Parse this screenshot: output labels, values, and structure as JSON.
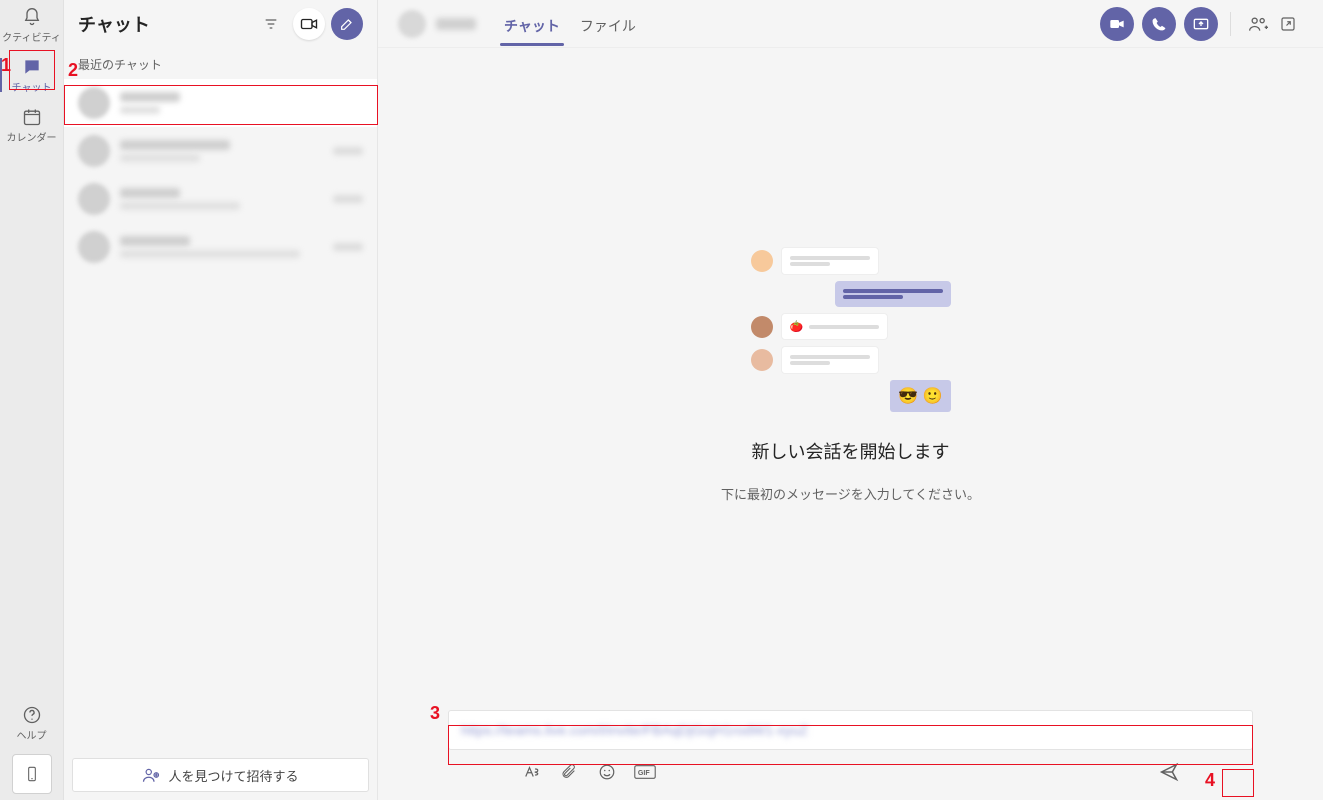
{
  "rail": {
    "activity": "クティビティ",
    "chat": "チャット",
    "calendar": "カレンダー",
    "help": "ヘルプ"
  },
  "pane": {
    "title": "チャット",
    "section_recent": "最近のチャット",
    "invite_label": "人を見つけて招待する"
  },
  "header": {
    "tab_chat": "チャット",
    "tab_files": "ファイル"
  },
  "empty": {
    "title": "新しい会話を開始します",
    "subtitle": "下に最初のメッセージを入力してください。",
    "emoji1": "😎",
    "emoji2": "🙂"
  },
  "callouts": {
    "n1": "1",
    "n2": "2",
    "n3": "3",
    "n4": "4"
  }
}
